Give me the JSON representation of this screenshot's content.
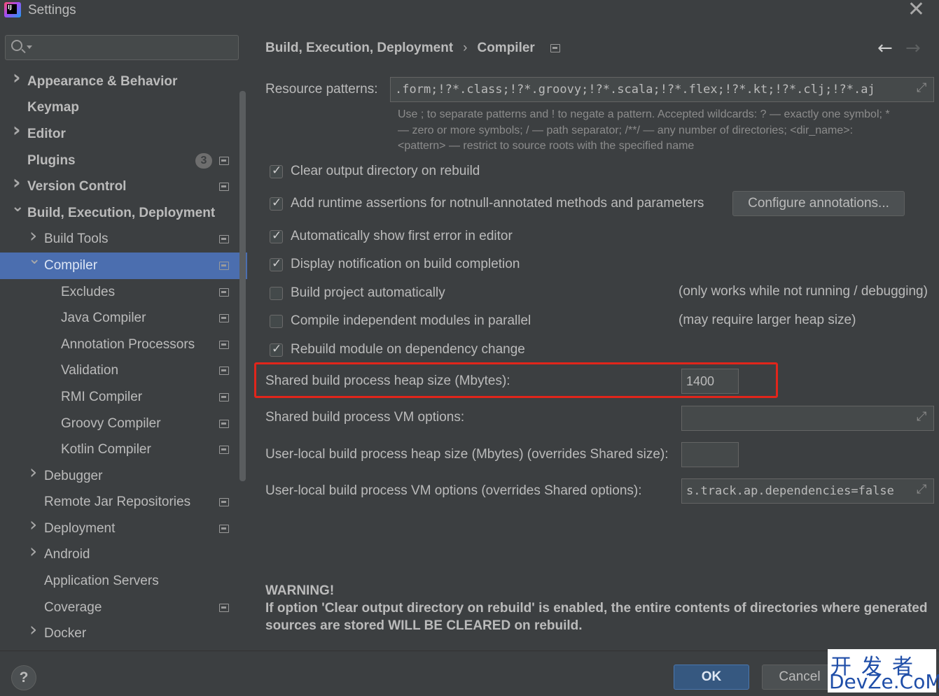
{
  "window": {
    "title": "Settings",
    "logo_text": "IJ"
  },
  "search": {
    "placeholder": "",
    "value": ""
  },
  "sidebar": {
    "items": [
      {
        "label": "Appearance & Behavior",
        "level": 0,
        "chevron": "right",
        "bold": true,
        "badge": "",
        "icon": false,
        "selected": false
      },
      {
        "label": "Keymap",
        "level": 0,
        "chevron": "none",
        "bold": true,
        "badge": "",
        "icon": false,
        "selected": false
      },
      {
        "label": "Editor",
        "level": 0,
        "chevron": "right",
        "bold": true,
        "badge": "",
        "icon": false,
        "selected": false
      },
      {
        "label": "Plugins",
        "level": 0,
        "chevron": "none",
        "bold": true,
        "badge": "3",
        "icon": true,
        "selected": false
      },
      {
        "label": "Version Control",
        "level": 0,
        "chevron": "right",
        "bold": true,
        "badge": "",
        "icon": true,
        "selected": false
      },
      {
        "label": "Build, Execution, Deployment",
        "level": 0,
        "chevron": "down",
        "bold": true,
        "badge": "",
        "icon": false,
        "selected": false
      },
      {
        "label": "Build Tools",
        "level": 1,
        "chevron": "right",
        "bold": false,
        "badge": "",
        "icon": true,
        "selected": false
      },
      {
        "label": "Compiler",
        "level": 1,
        "chevron": "down",
        "bold": false,
        "badge": "",
        "icon": true,
        "selected": true
      },
      {
        "label": "Excludes",
        "level": 2,
        "chevron": "none",
        "bold": false,
        "badge": "",
        "icon": true,
        "selected": false
      },
      {
        "label": "Java Compiler",
        "level": 2,
        "chevron": "none",
        "bold": false,
        "badge": "",
        "icon": true,
        "selected": false
      },
      {
        "label": "Annotation Processors",
        "level": 2,
        "chevron": "none",
        "bold": false,
        "badge": "",
        "icon": true,
        "selected": false
      },
      {
        "label": "Validation",
        "level": 2,
        "chevron": "none",
        "bold": false,
        "badge": "",
        "icon": true,
        "selected": false
      },
      {
        "label": "RMI Compiler",
        "level": 2,
        "chevron": "none",
        "bold": false,
        "badge": "",
        "icon": true,
        "selected": false
      },
      {
        "label": "Groovy Compiler",
        "level": 2,
        "chevron": "none",
        "bold": false,
        "badge": "",
        "icon": true,
        "selected": false
      },
      {
        "label": "Kotlin Compiler",
        "level": 2,
        "chevron": "none",
        "bold": false,
        "badge": "",
        "icon": true,
        "selected": false
      },
      {
        "label": "Debugger",
        "level": 1,
        "chevron": "right",
        "bold": false,
        "badge": "",
        "icon": false,
        "selected": false
      },
      {
        "label": "Remote Jar Repositories",
        "level": 1,
        "chevron": "none",
        "bold": false,
        "badge": "",
        "icon": true,
        "selected": false
      },
      {
        "label": "Deployment",
        "level": 1,
        "chevron": "right",
        "bold": false,
        "badge": "",
        "icon": true,
        "selected": false
      },
      {
        "label": "Android",
        "level": 1,
        "chevron": "right",
        "bold": false,
        "badge": "",
        "icon": false,
        "selected": false
      },
      {
        "label": "Application Servers",
        "level": 1,
        "chevron": "none",
        "bold": false,
        "badge": "",
        "icon": false,
        "selected": false
      },
      {
        "label": "Coverage",
        "level": 1,
        "chevron": "none",
        "bold": false,
        "badge": "",
        "icon": true,
        "selected": false
      },
      {
        "label": "Docker",
        "level": 1,
        "chevron": "right",
        "bold": false,
        "badge": "",
        "icon": false,
        "selected": false
      }
    ]
  },
  "breadcrumb": {
    "parent": "Build, Execution, Deployment",
    "separator": "›",
    "current": "Compiler"
  },
  "nav": {
    "back": "←",
    "forward": "→"
  },
  "resource_patterns": {
    "label": "Resource patterns:",
    "value": ".form;!?*.class;!?*.groovy;!?*.scala;!?*.flex;!?*.kt;!?*.clj;!?*.aj",
    "hint_line1": "Use ; to separate patterns and ! to negate a pattern. Accepted wildcards: ? — exactly one symbol; *",
    "hint_line2": "— zero or more symbols; / — path separator; /**/ — any number of directories; <dir_name>:",
    "hint_line3": "<pattern> — restrict to source roots with the specified name"
  },
  "options": {
    "clear_output": {
      "label": "Clear output directory on rebuild",
      "checked": true
    },
    "runtime_assertions": {
      "label": "Add runtime assertions for notnull-annotated methods and parameters",
      "checked": true
    },
    "configure_annotations": "Configure annotations...",
    "show_first_error": {
      "label": "Automatically show first error in editor",
      "checked": true
    },
    "notify_completion": {
      "label": "Display notification on build completion",
      "checked": true
    },
    "build_automatically": {
      "label": "Build project automatically",
      "checked": false,
      "note": "(only works while not running / debugging)"
    },
    "parallel": {
      "label": "Compile independent modules in parallel",
      "checked": false,
      "note": "(may require larger heap size)"
    },
    "rebuild_on_dependency": {
      "label": "Rebuild module on dependency change",
      "checked": true
    }
  },
  "heap": {
    "label": "Shared build process heap size (Mbytes):",
    "value": "1400"
  },
  "vm_options": {
    "label": "Shared build process VM options:",
    "value": ""
  },
  "user_heap": {
    "label": "User-local build process heap size (Mbytes) (overrides Shared size):",
    "value": ""
  },
  "user_vm": {
    "label": "User-local build process VM options (overrides Shared options):",
    "value": "s.track.ap.dependencies=false"
  },
  "warning": {
    "title": "WARNING!",
    "body": "If option 'Clear output directory on rebuild' is enabled, the entire contents of directories where generated sources are stored WILL BE CLEARED on rebuild."
  },
  "footer": {
    "help": "?",
    "ok": "OK",
    "cancel": "Cancel"
  },
  "watermark": {
    "top": "开发者",
    "bottom": "DevZe.CoM"
  },
  "colors": {
    "background": "#3c3f41",
    "selected": "#4b6eaf",
    "highlight": "#e1251b",
    "ok_button": "#365880"
  }
}
